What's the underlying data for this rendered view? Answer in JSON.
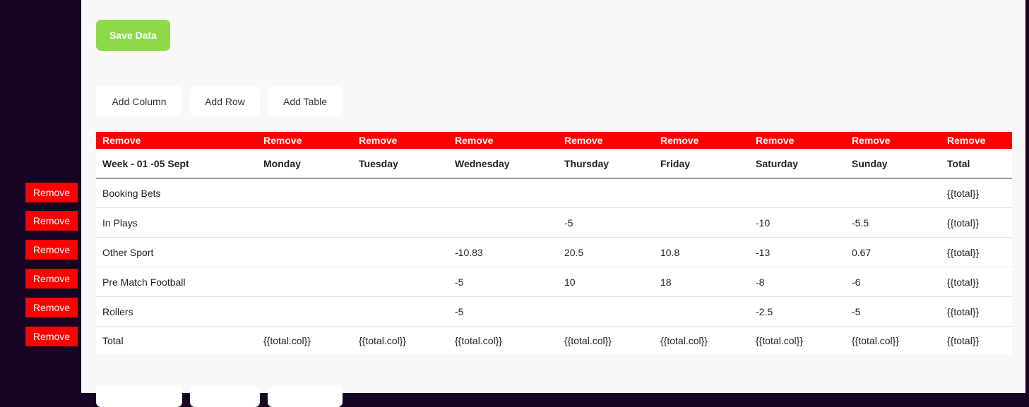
{
  "toolbar": {
    "save_label": "Save Data",
    "add_column": "Add Column",
    "add_row": "Add Row",
    "add_table": "Add Table"
  },
  "colors": {
    "sidebar": "#170424",
    "save": "#8cd94a",
    "remove": "#ff0000",
    "panel": "#f8f8f8"
  },
  "table": {
    "remove_label": "Remove",
    "headers": [
      "Week - 01 -05  Sept",
      "Monday",
      "Tuesday",
      "Wednesday",
      "Thursday",
      "Friday",
      "Saturday",
      "Sunday",
      "Total"
    ],
    "rows": [
      [
        "Booking Bets",
        "",
        "",
        "",
        "",
        "",
        "",
        "",
        "{{total}}"
      ],
      [
        "In Plays",
        "",
        "",
        "",
        "-5",
        "",
        "-10",
        "-5.5",
        "{{total}}"
      ],
      [
        "Other Sport",
        "",
        "",
        "-10.83",
        "20.5",
        "10.8",
        "-13",
        "0.67",
        "{{total}}"
      ],
      [
        "Pre Match Football",
        "",
        "",
        "-5",
        "10",
        "18",
        "-8",
        "-6",
        "{{total}}"
      ],
      [
        "Rollers",
        "",
        "",
        "-5",
        "",
        "",
        "-2.5",
        "-5",
        "{{total}}"
      ],
      [
        "Total",
        "{{total.col}}",
        "{{total.col}}",
        "{{total.col}}",
        "{{total.col}}",
        "{{total.col}}",
        "{{total.col}}",
        "{{total.col}}",
        "{{total}}"
      ]
    ]
  }
}
